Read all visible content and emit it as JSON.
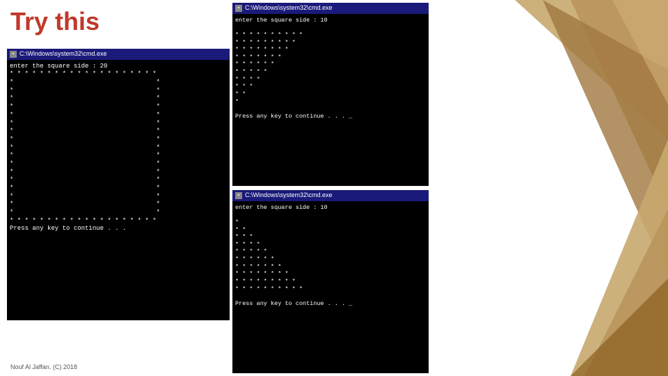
{
  "page": {
    "title": "Try this",
    "footer": "Nouf Al Jaffan. (C) 2018"
  },
  "terminal_left": {
    "titlebar": "C:\\Windows\\system32\\cmd.exe",
    "content": "enter the square side : 20\n* * * * * * * * * * * * * * * * * * * *\n*                                      *\n*                                      *\n*                                      *\n*                                      *\n*                                      *\n*                                      *\n*                                      *\n*                                      *\n*                                      *\n*                                      *\n*                                      *\n*                                      *\n*                                      *\n*                                      *\n*                                      *\n*                                      *\n*                                      *\n* * * * * * * * * * * * * * * * * * * *\nPress any key to continue . . ."
  },
  "terminal_top_right": {
    "titlebar": "C:\\Windows\\system32\\cmd.exe",
    "content": "enter the square side : 10\n\n* * * * * * * * * *\n* * * * * * * * *\n* * * * * * * *\n* * * * * * *\n* * * * * *\n* * * * *\n* * * *\n* * *\n* *\n*\n\nPress any key to continue . . . _"
  },
  "terminal_bottom_right": {
    "titlebar": "C:\\Windows\\system32\\cmd.exe",
    "content": "enter the square side : 10\n\n*\n* *\n* * *\n* * * *\n* * * * *\n* * * * * *\n* * * * * * *\n* * * * * * * *\n* * * * * * * * *\n* * * * * * * * * *\n\nPress any key to continue . . . _"
  }
}
